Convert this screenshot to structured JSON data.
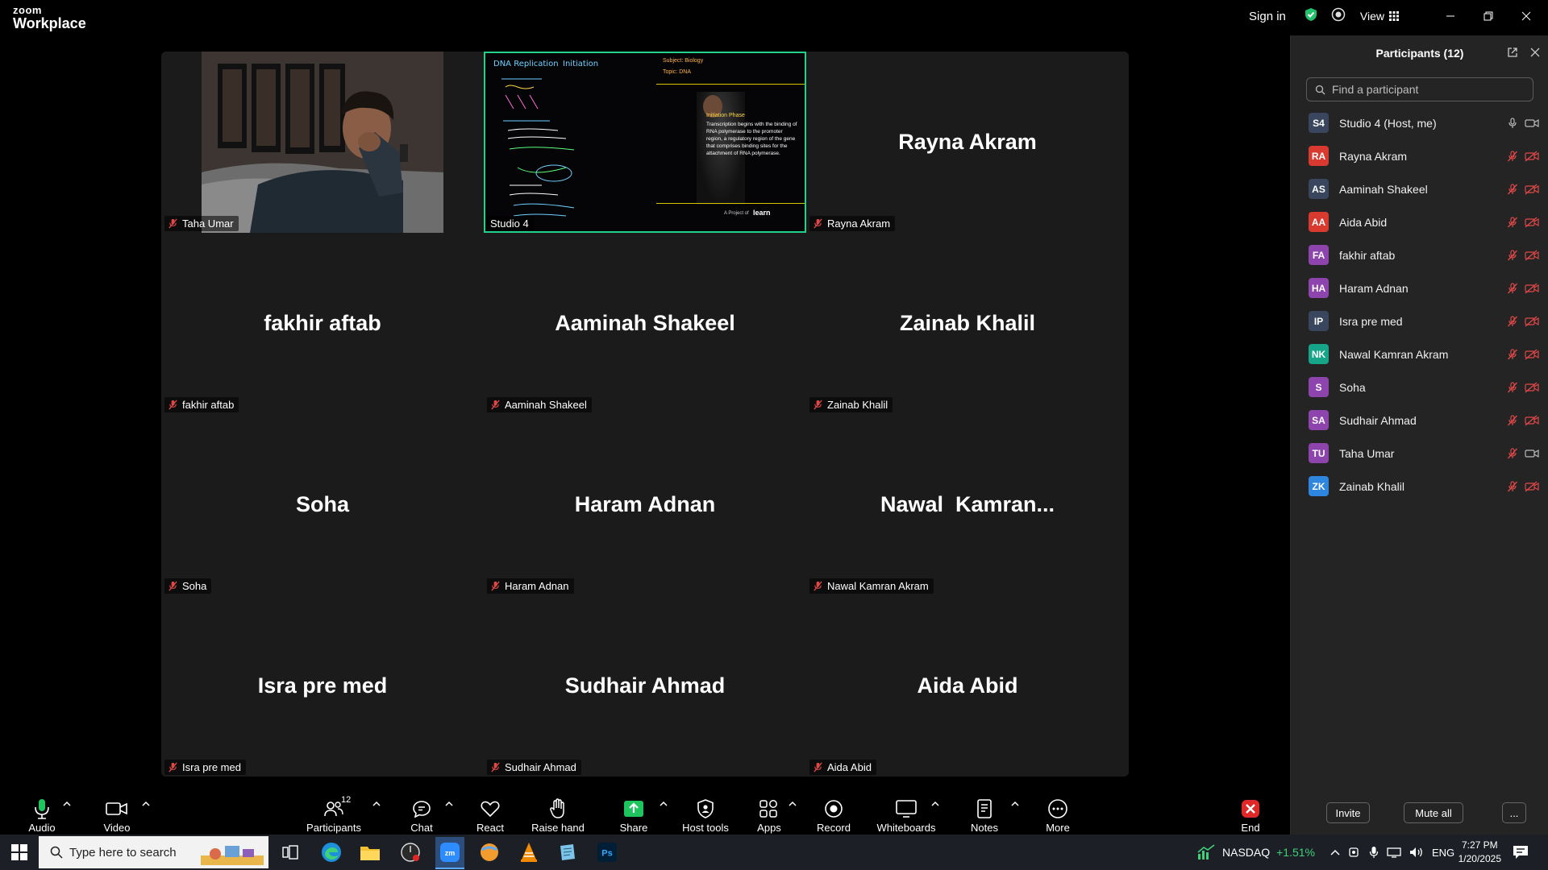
{
  "app": {
    "brand_line1": "zoom",
    "brand_line2": "Workplace",
    "sign_in": "Sign in",
    "view_label": "View"
  },
  "gallery": {
    "tiles": [
      {
        "big": "",
        "label": "Taha Umar",
        "type": "video"
      },
      {
        "big": "",
        "label": "Studio 4",
        "type": "screen"
      },
      {
        "big": "Rayna Akram",
        "label": "Rayna Akram",
        "type": "name"
      },
      {
        "big": "fakhir aftab",
        "label": "fakhir aftab",
        "type": "name"
      },
      {
        "big": "Aaminah Shakeel",
        "label": "Aaminah Shakeel",
        "type": "name"
      },
      {
        "big": "Zainab Khalil",
        "label": "Zainab Khalil",
        "type": "name"
      },
      {
        "big": "Soha",
        "label": "Soha",
        "type": "name"
      },
      {
        "big": "Haram Adnan",
        "label": "Haram Adnan",
        "type": "name"
      },
      {
        "big": "Nawal  Kamran...",
        "label": "Nawal Kamran Akram",
        "type": "name"
      },
      {
        "big": "Isra pre med",
        "label": "Isra pre med",
        "type": "name"
      },
      {
        "big": "Sudhair Ahmad",
        "label": "Sudhair Ahmad",
        "type": "name"
      },
      {
        "big": "Aida Abid",
        "label": "Aida Abid",
        "type": "name"
      }
    ],
    "slide": {
      "title_left": "DNA Replication",
      "title_right": "Initiation",
      "subject": "Subject: Biology",
      "topic": "Topic:  DNA",
      "heading": "Initiation Phase",
      "body": "Transcription begins with the binding of RNA polymerase to the promoter region, a regulatory region of the gene that comprises binding sites for the attachment of RNA polymerase.",
      "footer": "A Project of",
      "footer_brand": "learn"
    }
  },
  "panel": {
    "title": "Participants (12)",
    "search_placeholder": "Find a participant",
    "participants": [
      {
        "initials": "S4",
        "name": "Studio 4 (Host, me)",
        "color": "#39465e",
        "mic": "on",
        "cam": "on"
      },
      {
        "initials": "RA",
        "name": "Rayna Akram",
        "color": "#d83a2f",
        "mic": "off",
        "cam": "off"
      },
      {
        "initials": "AS",
        "name": "Aaminah Shakeel",
        "color": "#39465e",
        "mic": "off",
        "cam": "off"
      },
      {
        "initials": "AA",
        "name": "Aida Abid",
        "color": "#d83a2f",
        "mic": "off",
        "cam": "off"
      },
      {
        "initials": "FA",
        "name": "fakhir aftab",
        "color": "#8e44ad",
        "mic": "off",
        "cam": "off"
      },
      {
        "initials": "HA",
        "name": "Haram Adnan",
        "color": "#8e44ad",
        "mic": "off",
        "cam": "off"
      },
      {
        "initials": "IP",
        "name": "Isra pre med",
        "color": "#39465e",
        "mic": "off",
        "cam": "off"
      },
      {
        "initials": "NK",
        "name": "Nawal Kamran Akram",
        "color": "#17a589",
        "mic": "off",
        "cam": "off"
      },
      {
        "initials": "S",
        "name": "Soha",
        "color": "#8e44ad",
        "mic": "off",
        "cam": "off"
      },
      {
        "initials": "SA",
        "name": "Sudhair Ahmad",
        "color": "#8e44ad",
        "mic": "off",
        "cam": "off"
      },
      {
        "initials": "TU",
        "name": "Taha Umar",
        "color": "#8e44ad",
        "mic": "off",
        "cam": "on"
      },
      {
        "initials": "ZK",
        "name": "Zainab Khalil",
        "color": "#2e86de",
        "mic": "off",
        "cam": "off"
      }
    ],
    "invite": "Invite",
    "mute_all": "Mute all",
    "more": "..."
  },
  "toolbar": {
    "audio": "Audio",
    "video": "Video",
    "participants": "Participants",
    "participants_count": "12",
    "chat": "Chat",
    "react": "React",
    "raise_hand": "Raise hand",
    "share": "Share",
    "host_tools": "Host tools",
    "apps": "Apps",
    "record": "Record",
    "whiteboards": "Whiteboards",
    "notes": "Notes",
    "more": "More",
    "end": "End"
  },
  "taskbar": {
    "search_placeholder": "Type here to search",
    "ticker": "NASDAQ",
    "ticker_change": "+1.51%",
    "lang": "ENG",
    "time": "7:27 PM",
    "date": "1/20/2025"
  },
  "colors": {
    "accent_green": "#23d18b",
    "muted_red": "#e04848",
    "share_green": "#1ec55f",
    "end_red": "#e02828"
  }
}
